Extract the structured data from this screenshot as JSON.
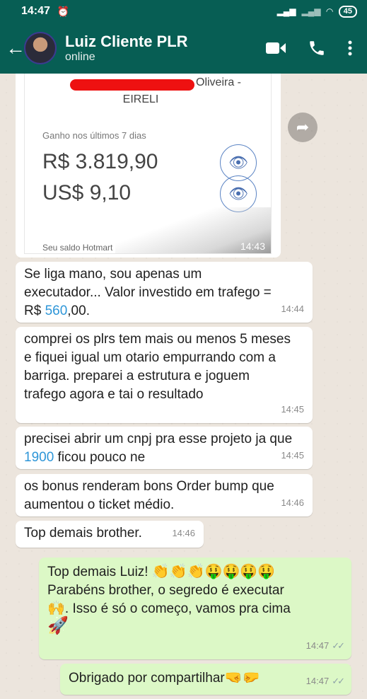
{
  "status_bar": {
    "time": "14:47",
    "alarm_icon": "alarm-icon",
    "battery": "45"
  },
  "header": {
    "back_icon": "arrow-back-icon",
    "contact_name": "Luiz Cliente PLR",
    "contact_status": "online",
    "video_icon": "video-call-icon",
    "phone_icon": "phone-icon",
    "menu_icon": "more-vert-icon"
  },
  "image_message": {
    "company_line1": "Oliveira -",
    "company_line2": "EIRELI",
    "period_label": "Ganho nos últimos 7 dias",
    "amount_brl": "R$ 3.819,90",
    "amount_usd": "US$ 9,10",
    "footer_label": "Seu saldo Hotmart",
    "time": "14:43"
  },
  "messages": [
    {
      "dir": "in",
      "line1": "Se liga mano, sou apenas um",
      "line2": "executador... Valor investido em trafego =",
      "line3_pre": "R$ ",
      "line3_num": "560",
      "line3_post": ",00.",
      "time": "14:44"
    },
    {
      "dir": "in",
      "text": "comprei os plrs tem mais ou menos 5 meses e fiquei igual um otario empurrando com a barriga. preparei a estrutura e joguem trafego agora e tai o resultado",
      "time": "14:45"
    },
    {
      "dir": "in",
      "pre": "precisei abrir um cnpj pra esse projeto ja que ",
      "num": "1900",
      "post": " ficou pouco ne",
      "time": "14:45"
    },
    {
      "dir": "in",
      "text": "os bonus renderam bons Order bump que aumentou o ticket médio.",
      "time": "14:46"
    },
    {
      "dir": "in",
      "text": "Top demais brother.",
      "time": "14:46"
    },
    {
      "dir": "out",
      "line1": "Top demais Luiz!",
      "line2": "Parabéns  brother, o segredo é executar",
      "line3": ". Isso é só o começo, vamos pra cima",
      "time": "14:47"
    },
    {
      "dir": "out",
      "text": "Obrigado por compartilhar",
      "time": "14:47"
    }
  ]
}
